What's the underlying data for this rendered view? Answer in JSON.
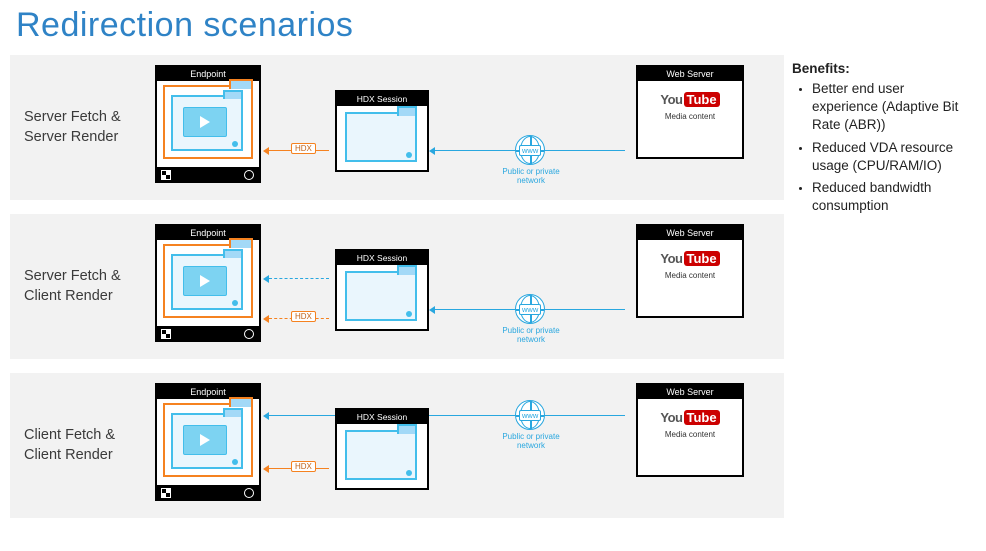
{
  "title": "Redirection scenarios",
  "scenarios": [
    {
      "label_line1": "Server Fetch &",
      "label_line2": "Server Render"
    },
    {
      "label_line1": "Server Fetch &",
      "label_line2": "Client Render"
    },
    {
      "label_line1": "Client Fetch &",
      "label_line2": "Client Render"
    }
  ],
  "boxes": {
    "endpoint": "Endpoint",
    "hdx_session": "HDX Session",
    "web_server": "Web Server"
  },
  "labels": {
    "hdx": "HDX",
    "www": "www",
    "network": "Public or private network",
    "media_content": "Media content",
    "youtube_you": "You",
    "youtube_tube": "Tube"
  },
  "benefits": {
    "heading": "Benefits:",
    "items": [
      "Better end user experience (Adaptive Bit Rate (ABR))",
      "Reduced VDA resource usage (CPU/RAM/IO)",
      "Reduced bandwidth consumption"
    ]
  }
}
